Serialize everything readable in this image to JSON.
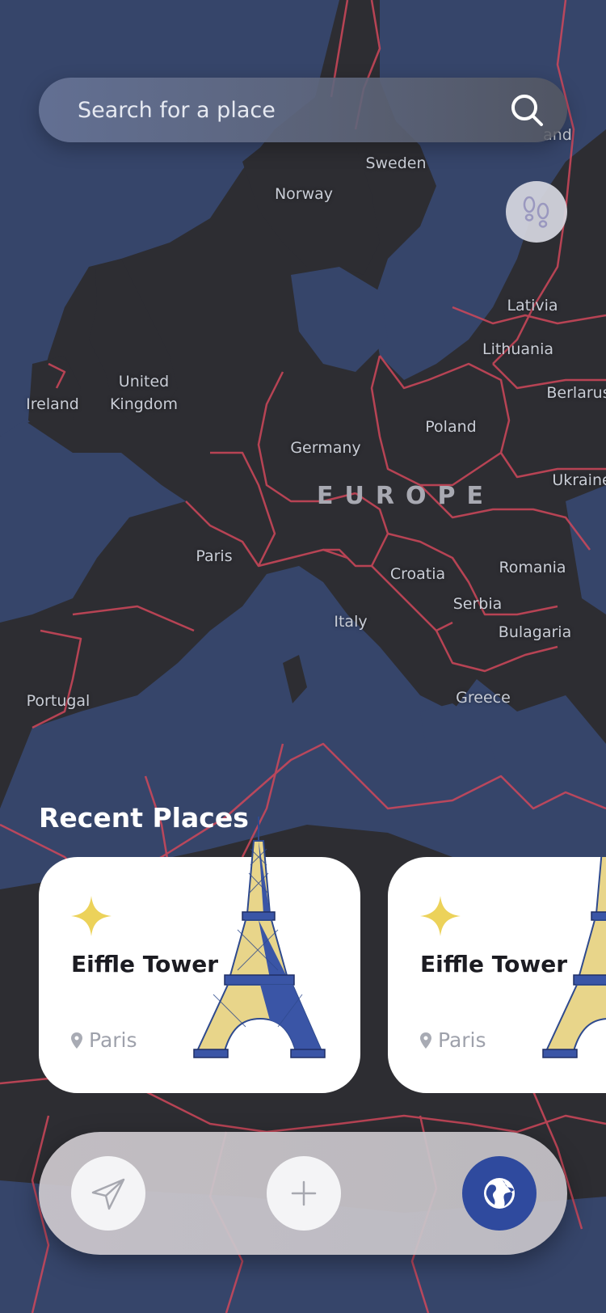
{
  "search": {
    "placeholder": "Search for a place"
  },
  "map": {
    "region": "EUROPE",
    "labels": [
      "and",
      "Sweden",
      "Norway",
      "Lativia",
      "Lithuania",
      "Berlarus",
      "United Kingdom",
      "Ireland",
      "Poland",
      "Germany",
      "Ukraine",
      "Paris",
      "Croatia",
      "Romania",
      "Serbia",
      "Bulagaria",
      "Italy",
      "Portugal",
      "Greece"
    ],
    "colors": {
      "sea": "#36456a",
      "land": "#2d2d32",
      "border": "#d0485a"
    }
  },
  "recent": {
    "title": "Recent Places",
    "cards": [
      {
        "title": "Eiffle Tower",
        "location": "Paris"
      },
      {
        "title": "Eiffle Tower",
        "location": "Paris"
      }
    ]
  },
  "nav": {
    "items": [
      {
        "icon": "send-icon",
        "active": false
      },
      {
        "icon": "plus-icon",
        "active": false
      },
      {
        "icon": "globe-icon",
        "active": true
      }
    ],
    "accent": "#2f4a9e"
  },
  "star_color": "#ecd25a"
}
